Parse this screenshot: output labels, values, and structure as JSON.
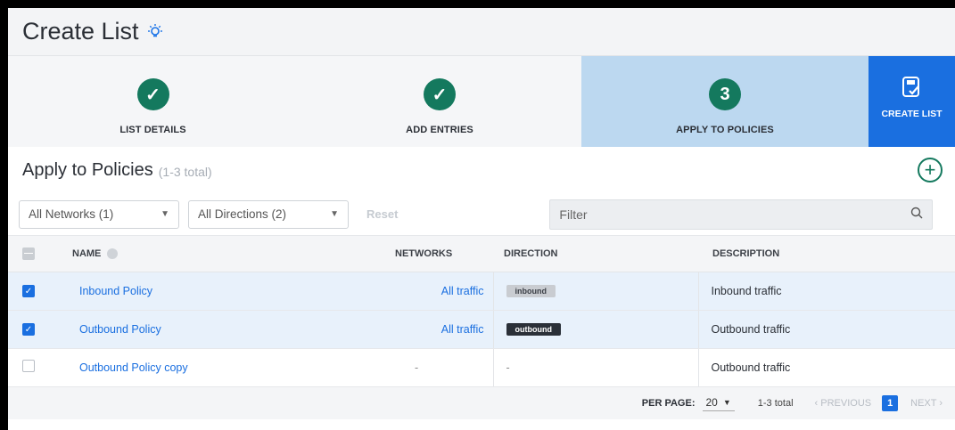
{
  "title": "Create List",
  "wizard": {
    "steps": [
      {
        "label": "LIST DETAILS",
        "marker": "✓"
      },
      {
        "label": "ADD ENTRIES",
        "marker": "✓"
      },
      {
        "label": "APPLY TO POLICIES",
        "marker": "3"
      }
    ],
    "create_label": "CREATE LIST"
  },
  "section": {
    "title": "Apply to Policies",
    "count": "(1-3 total)"
  },
  "filters": {
    "networks": "All Networks (1)",
    "directions": "All Directions (2)",
    "reset": "Reset",
    "filter_placeholder": "Filter"
  },
  "table": {
    "headers": {
      "name": "NAME",
      "networks": "NETWORKS",
      "direction": "DIRECTION",
      "description": "DESCRIPTION"
    },
    "rows": [
      {
        "name": "Inbound Policy",
        "networks": "All traffic",
        "direction": "inbound",
        "description": "Inbound traffic",
        "checked": true
      },
      {
        "name": "Outbound Policy",
        "networks": "All traffic",
        "direction": "outbound",
        "description": "Outbound traffic",
        "checked": true
      },
      {
        "name": "Outbound Policy copy",
        "networks": "-",
        "direction": "-",
        "description": "Outbound traffic",
        "checked": false
      }
    ]
  },
  "pager": {
    "per_page_label": "PER PAGE:",
    "per_page": "20",
    "total": "1-3 total",
    "previous": "PREVIOUS",
    "page": "1",
    "next": "NEXT"
  },
  "colors": {
    "accent": "#1a6fe0",
    "success": "#14795e",
    "active_step_bg": "#bcd8f0"
  }
}
